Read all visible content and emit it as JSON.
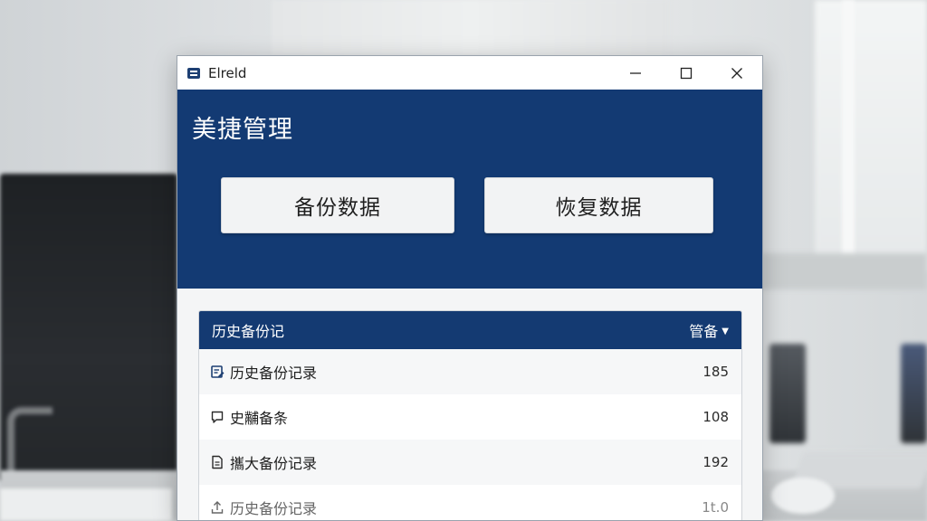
{
  "window": {
    "app_title": "Elreld",
    "icons": {
      "app": "app-logo-icon",
      "minimize": "minimize-icon",
      "maximize": "maximize-icon",
      "close": "close-icon"
    }
  },
  "hero": {
    "title": "美捷管理",
    "backup_label": "备份数据",
    "restore_label": "恢复数据"
  },
  "history": {
    "title": "历史备份记",
    "filter_label": "管备",
    "rows": [
      {
        "icon": "document-edit-icon",
        "label": "历史备份记录",
        "count": "185"
      },
      {
        "icon": "comment-icon",
        "label": "史黼备条",
        "count": "108"
      },
      {
        "icon": "document-icon",
        "label": "攜大备份记录",
        "count": "192"
      },
      {
        "icon": "upload-icon",
        "label": "历史备份记录",
        "count": "1t.0"
      }
    ]
  },
  "colors": {
    "brand_blue": "#133a73",
    "button_bg": "#f2f3f4",
    "list_bg": "#ffffff"
  }
}
